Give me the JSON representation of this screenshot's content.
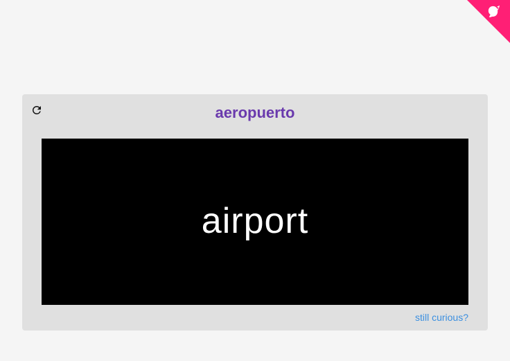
{
  "corner": {
    "icon": "github-octocat-icon",
    "color": "#ff1f75"
  },
  "card": {
    "refresh_icon": "refresh-icon",
    "word": "aeropuerto",
    "translation": "airport",
    "link_label": "still curious?"
  },
  "colors": {
    "accent_title": "#6a3aad",
    "link": "#3b8fe0",
    "flashcard_bg": "#000000",
    "card_bg": "#e0e0e0"
  }
}
